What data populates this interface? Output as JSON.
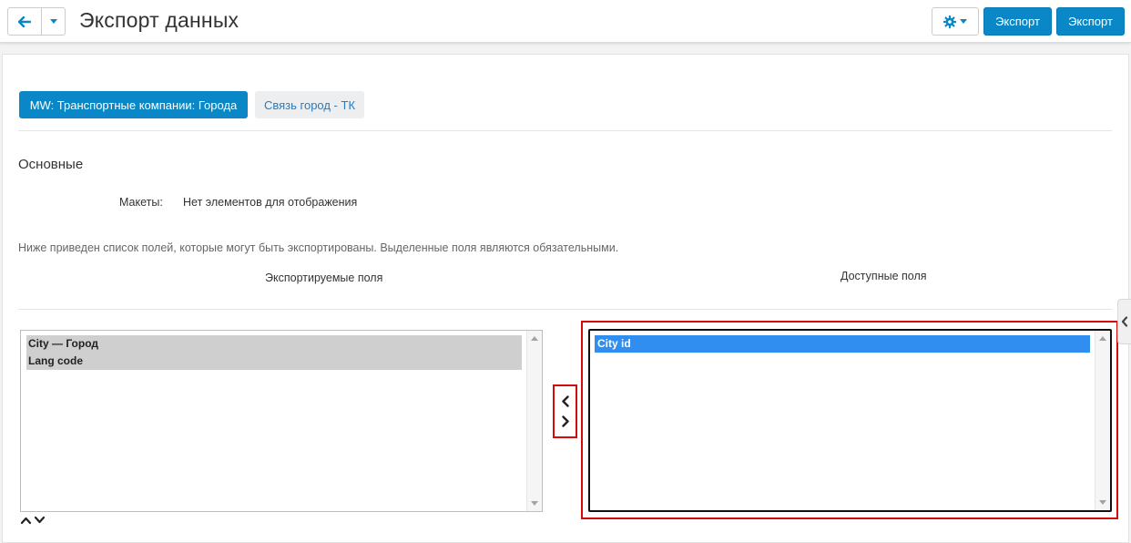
{
  "header": {
    "title": "Экспорт данных",
    "export_button_1": "Экспорт",
    "export_button_2": "Экспорт"
  },
  "tabs": [
    {
      "label": "MW: Транспортные компании: Города",
      "active": true
    },
    {
      "label": "Связь город - ТК",
      "active": false
    }
  ],
  "section": {
    "title": "Основные",
    "makety_label": "Макеты:",
    "makety_value": "Нет элементов для отображения",
    "hint": "Ниже приведен список полей, которые могут быть экспортированы. Выделенные поля являются обязательными.",
    "exported_fields_heading": "Экспортируемые поля",
    "available_fields_heading": "Доступные поля"
  },
  "exported_fields": [
    {
      "prefix": "City — ",
      "name": "Город"
    },
    {
      "prefix": "",
      "name": "Lang code"
    }
  ],
  "available_fields": [
    {
      "label": "City id",
      "selected": true
    }
  ],
  "colors": {
    "primary": "#0a87c6",
    "highlight_frame": "#d30b0b",
    "selection": "#2f8ef0"
  }
}
